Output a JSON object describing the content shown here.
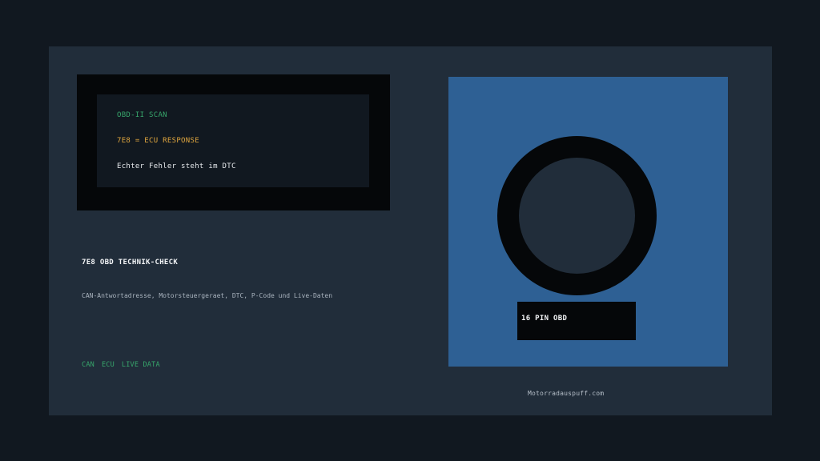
{
  "terminal": {
    "line1": "OBD-II SCAN",
    "line2": "7E8 = ECU RESPONSE",
    "line3": "Echter Fehler steht im DTC",
    "colors": {
      "green": "#37a66b",
      "amber": "#e0a63e",
      "white": "#e6e9ec"
    }
  },
  "content": {
    "heading": "7E8 OBD TECHNIK-CHECK",
    "subheading": "CAN-Antwortadresse, Motorsteuergeraet, DTC, P-Code und Live-Daten",
    "tags": [
      "CAN",
      "ECU",
      "LIVE DATA"
    ]
  },
  "illustration": {
    "connector_label": "16 PIN OBD",
    "panel_color": "#2e6094"
  },
  "footer": {
    "site": "Motorradauspuff.com"
  }
}
